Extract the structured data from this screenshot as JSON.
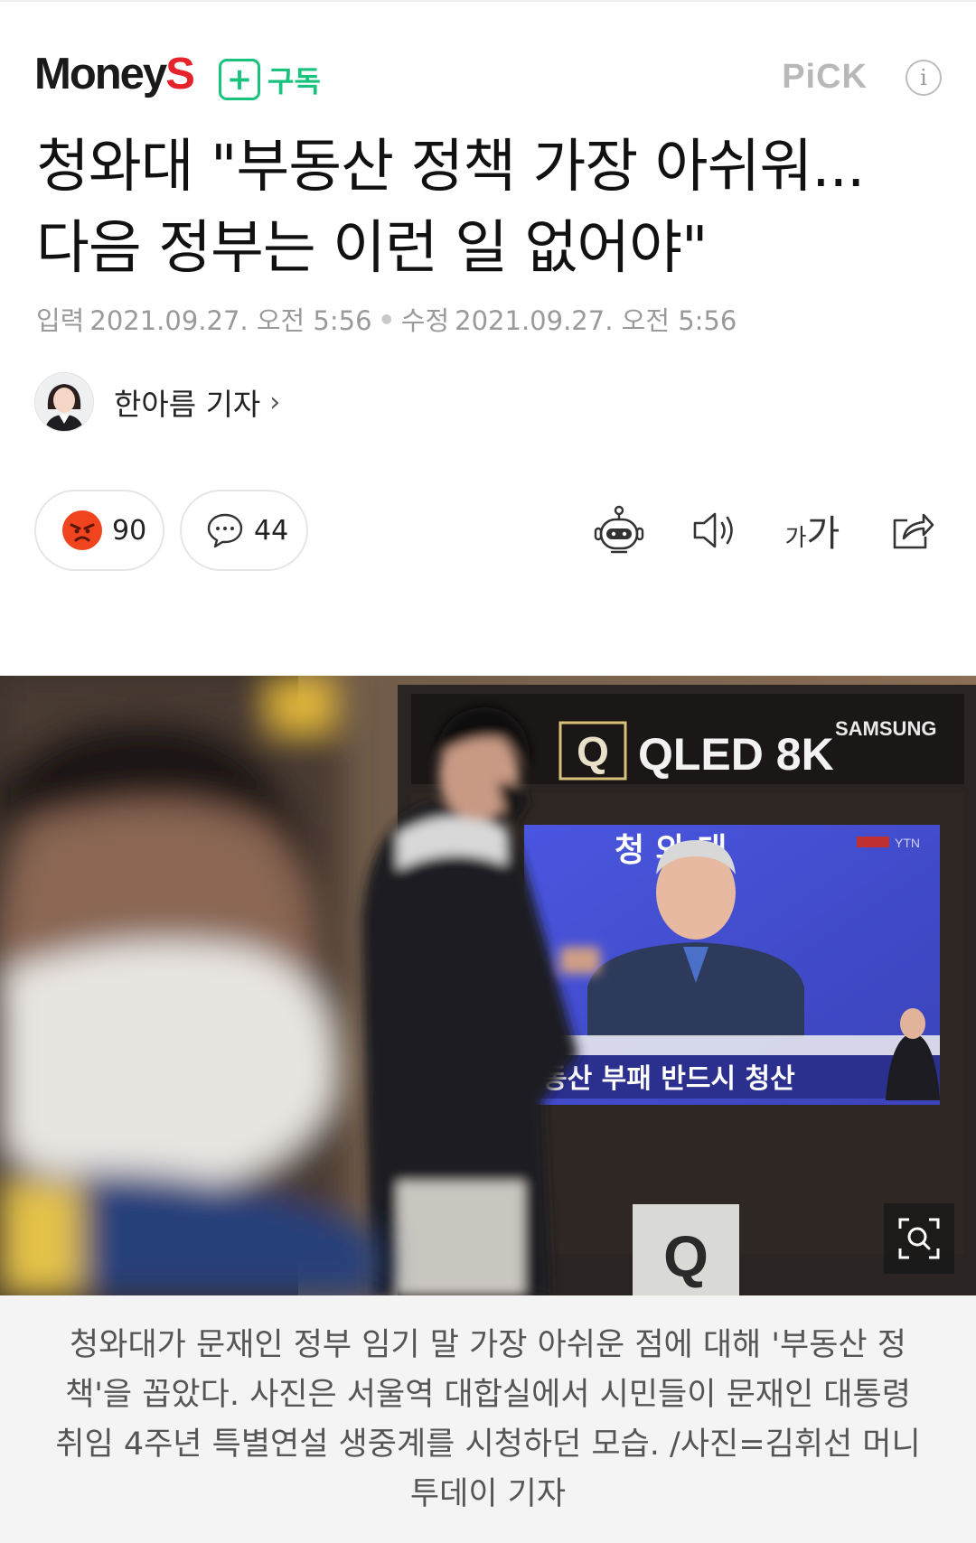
{
  "header": {
    "logo_main": "Money",
    "logo_accent": "S",
    "subscribe_label": "구독",
    "pick_label": "PiCK",
    "info_label": "i"
  },
  "article": {
    "title_line1": "청와대 \"부동산 정책 가장 아쉬워...",
    "title_line2": "다음 정부는 이런 일 없어야\"",
    "input_label": "입력",
    "input_datetime": "2021.09.27. 오전 5:56",
    "modified_label": "수정",
    "modified_datetime": "2021.09.27. 오전 5:56",
    "author": "한아름 기자"
  },
  "actions": {
    "reaction_count": "90",
    "comment_count": "44",
    "font_small": "가",
    "font_large": "가"
  },
  "photo": {
    "tv_brand": "QLED 8K",
    "tv_maker": "SAMSUNG",
    "tv_title": "청 와 대",
    "tv_channel": "YTN",
    "tv_caption": "동산 부패 반드시 청산"
  },
  "caption": {
    "text": "청와대가 문재인 정부 임기 말 가장 아쉬운 점에 대해 '부동산 정책'을 꼽았다. 사진은 서울역 대합실에서 시민들이 문재인 대통령 취임 4주년 특별연설 생중계를 시청하던 모습. /사진=김휘선 머니투데이 기자"
  },
  "colors": {
    "brand_red": "#e6222a",
    "subscribe_green": "#19c37d",
    "meta_gray": "#9a9a9a",
    "caption_bg": "#f4f4f4"
  },
  "icons": {
    "reaction": "angry-face-icon",
    "comment": "speech-bubble-icon",
    "summary_bot": "robot-icon",
    "read_aloud": "speaker-icon",
    "font_size": "font-size-icon",
    "share": "share-icon",
    "zoom": "zoom-icon"
  }
}
